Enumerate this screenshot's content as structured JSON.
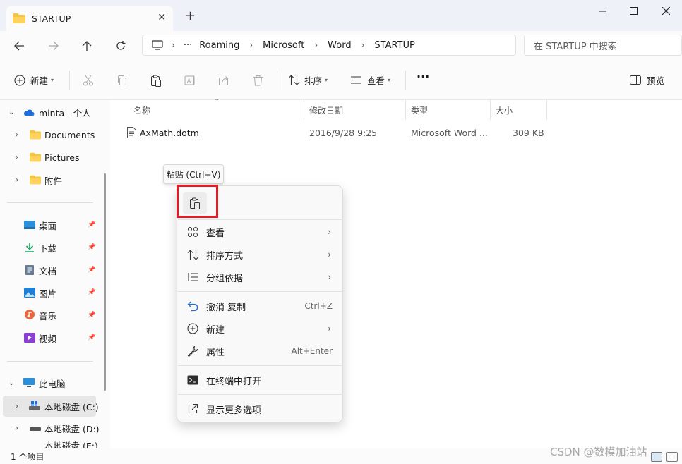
{
  "window": {
    "tab_title": "STARTUP",
    "new_tab": "+",
    "close_tab": "✕"
  },
  "nav": {
    "breadcrumb": [
      "Roaming",
      "Microsoft",
      "Word",
      "STARTUP"
    ],
    "more_crumbs": "···",
    "search_placeholder": "在 STARTUP 中搜索"
  },
  "toolbar": {
    "new_label": "新建",
    "sort_label": "排序",
    "view_label": "查看",
    "more": "···",
    "preview_label": "预览"
  },
  "sidebar": {
    "onedrive": "minta - 个人",
    "items": [
      "Documents",
      "Pictures",
      "附件"
    ],
    "quick": [
      "桌面",
      "下载",
      "文档",
      "图片",
      "音乐",
      "视频"
    ],
    "this_pc": "此电脑",
    "drives": [
      "本地磁盘 (C:)",
      "本地磁盘 (D:)",
      "本地磁盘 (E:)"
    ]
  },
  "columns": {
    "name": "名称",
    "modified": "修改日期",
    "type": "类型",
    "size": "大小"
  },
  "files": [
    {
      "name": "AxMath.dotm",
      "modified": "2016/9/28 9:25",
      "type": "Microsoft Word ...",
      "size": "309 KB"
    }
  ],
  "tooltip": "粘贴 (Ctrl+V)",
  "context_menu": {
    "view": "查看",
    "sort_by": "排序方式",
    "group_by": "分组依据",
    "undo": "撤消 复制",
    "undo_shortcut": "Ctrl+Z",
    "new": "新建",
    "properties": "属性",
    "properties_shortcut": "Alt+Enter",
    "open_terminal": "在终端中打开",
    "more_options": "显示更多选项"
  },
  "status": {
    "count": "1 个项目"
  },
  "watermark": "CSDN @数模加油站",
  "colors": {
    "highlight_box": "#e51a25",
    "accent": "#0067c0"
  }
}
